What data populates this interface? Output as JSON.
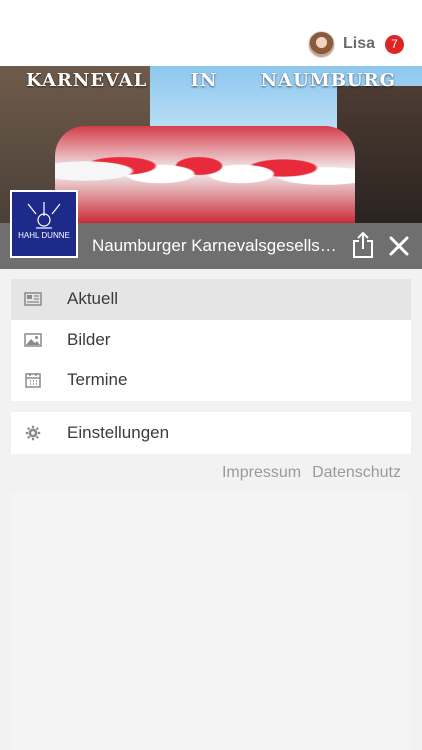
{
  "user": {
    "name": "Lisa",
    "badge_count": "7"
  },
  "hero": {
    "title": "KARNEVAL IN NAUMBURG"
  },
  "club": {
    "logo_text": "HAHL DUNNE",
    "name": "Naumburger Karnevalsgesells…"
  },
  "menu": {
    "items": [
      {
        "label": "Aktuell",
        "icon": "newspaper-icon",
        "active": true
      },
      {
        "label": "Bilder",
        "icon": "image-icon"
      },
      {
        "label": "Termine",
        "icon": "calendar-icon"
      }
    ],
    "settings": {
      "label": "Einstellungen",
      "icon": "gear-icon"
    }
  },
  "footer": {
    "impressum": "Impressum",
    "datenschutz": "Datenschutz"
  },
  "colors": {
    "badge": "#e02323",
    "caption_bar": "#6f6f6f",
    "active_item": "#e5e5e5",
    "logo_bg": "#1d2a8a"
  }
}
